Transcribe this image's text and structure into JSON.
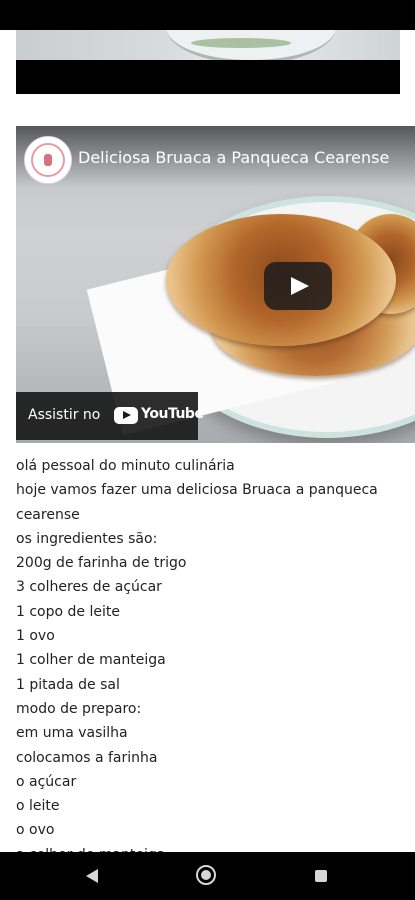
{
  "video": {
    "title": "Deliciosa Bruaca a Panqueca Cearense",
    "watch_on_label": "Assistir no",
    "youtube_logo_text": "YouTube",
    "play_icon": "play-icon"
  },
  "description": {
    "lines": [
      "olá pessoal do minuto culinária",
      "hoje vamos fazer uma deliciosa Bruaca a panqueca",
      "cearense",
      "os ingredientes são:",
      "200g de farinha de trigo",
      "3 colheres de açúcar",
      "1 copo de leite",
      "1 ovo",
      "1 colher de manteiga",
      "1 pitada de sal",
      "modo de preparo:",
      "em uma vasilha",
      "colocamos a farinha",
      "o açúcar",
      "o leite",
      "o ovo",
      "a colher de manteiga"
    ]
  },
  "navigation": {
    "back_icon": "back-triangle-icon",
    "home_icon": "home-circle-icon",
    "recents_icon": "recents-square-icon"
  },
  "colors": {
    "text": "#222222",
    "bars": "#000000",
    "video_overlay": "#1c1c1c"
  }
}
